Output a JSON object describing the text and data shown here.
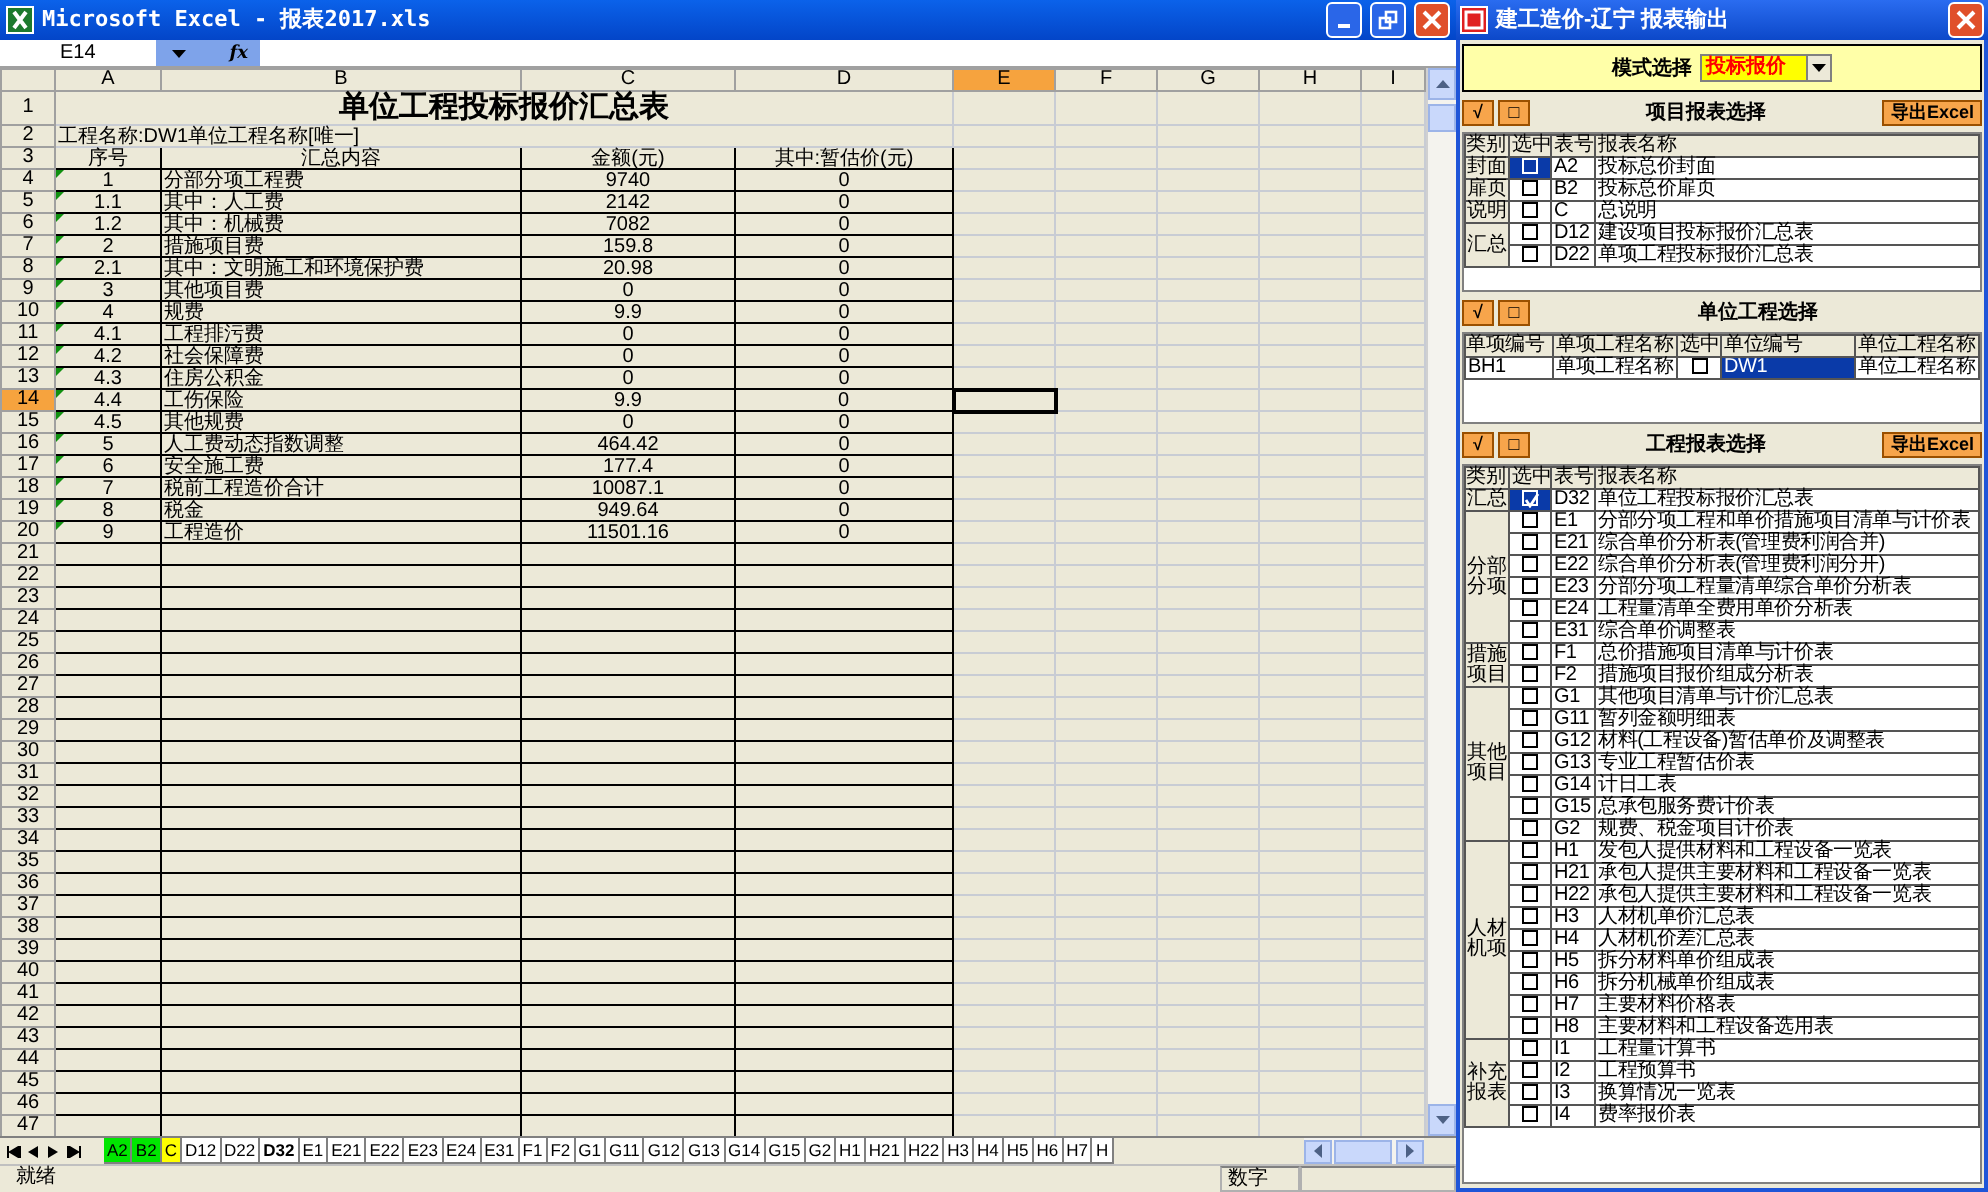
{
  "excel": {
    "title": "Microsoft Excel - 报表2017.xls",
    "name_box": "E14",
    "fx": "fx",
    "columns": [
      {
        "label": "A",
        "selected": false
      },
      {
        "label": "B",
        "selected": false
      },
      {
        "label": "C",
        "selected": false
      },
      {
        "label": "D",
        "selected": false
      },
      {
        "label": "E",
        "selected": true
      },
      {
        "label": "F",
        "selected": false
      },
      {
        "label": "G",
        "selected": false
      },
      {
        "label": "H",
        "selected": false
      },
      {
        "label": "I",
        "selected": false
      }
    ],
    "row_headers": [
      {
        "label": "1",
        "selected": false
      },
      {
        "label": "2",
        "selected": false
      },
      {
        "label": "3",
        "selected": false
      },
      {
        "label": "4",
        "selected": false
      },
      {
        "label": "5",
        "selected": false
      },
      {
        "label": "6",
        "selected": false
      },
      {
        "label": "7",
        "selected": false
      },
      {
        "label": "8",
        "selected": false
      },
      {
        "label": "9",
        "selected": false
      },
      {
        "label": "10",
        "selected": false
      },
      {
        "label": "11",
        "selected": false
      },
      {
        "label": "12",
        "selected": false
      },
      {
        "label": "13",
        "selected": false
      },
      {
        "label": "14",
        "selected": true
      },
      {
        "label": "15",
        "selected": false
      },
      {
        "label": "16",
        "selected": false
      },
      {
        "label": "17",
        "selected": false
      },
      {
        "label": "18",
        "selected": false
      },
      {
        "label": "19",
        "selected": false
      },
      {
        "label": "20",
        "selected": false
      },
      {
        "label": "21",
        "selected": false
      },
      {
        "label": "22",
        "selected": false
      },
      {
        "label": "23",
        "selected": false
      },
      {
        "label": "24",
        "selected": false
      },
      {
        "label": "25",
        "selected": false
      },
      {
        "label": "26",
        "selected": false
      },
      {
        "label": "27",
        "selected": false
      },
      {
        "label": "28",
        "selected": false
      },
      {
        "label": "29",
        "selected": false
      },
      {
        "label": "30",
        "selected": false
      },
      {
        "label": "31",
        "selected": false
      },
      {
        "label": "32",
        "selected": false
      },
      {
        "label": "33",
        "selected": false
      },
      {
        "label": "34",
        "selected": false
      },
      {
        "label": "35",
        "selected": false
      },
      {
        "label": "36",
        "selected": false
      },
      {
        "label": "37",
        "selected": false
      },
      {
        "label": "38",
        "selected": false
      },
      {
        "label": "39",
        "selected": false
      },
      {
        "label": "40",
        "selected": false
      },
      {
        "label": "41",
        "selected": false
      },
      {
        "label": "42",
        "selected": false
      },
      {
        "label": "43",
        "selected": false
      },
      {
        "label": "44",
        "selected": false
      },
      {
        "label": "45",
        "selected": false
      },
      {
        "label": "46",
        "selected": false
      },
      {
        "label": "47",
        "selected": false
      }
    ],
    "sheet_title": "单位工程投标报价汇总表",
    "project_line": "工程名称:DW1单位工程名称[唯一]",
    "table_header": [
      "序号",
      "汇总内容",
      "金额(元)",
      "其中:暂估价(元)"
    ],
    "rows": [
      [
        "1",
        "分部分项工程费",
        "9740",
        "0"
      ],
      [
        "1.1",
        "其中：人工费",
        "2142",
        "0"
      ],
      [
        "1.2",
        "其中：机械费",
        "7082",
        "0"
      ],
      [
        "2",
        "措施项目费",
        "159.8",
        "0"
      ],
      [
        "2.1",
        "其中：文明施工和环境保护费",
        "20.98",
        "0"
      ],
      [
        "3",
        "其他项目费",
        "0",
        "0"
      ],
      [
        "4",
        "规费",
        "9.9",
        "0"
      ],
      [
        "4.1",
        "工程排污费",
        "0",
        "0"
      ],
      [
        "4.2",
        "社会保障费",
        "0",
        "0"
      ],
      [
        "4.3",
        "住房公积金",
        "0",
        "0"
      ],
      [
        "4.4",
        "工伤保险",
        "9.9",
        "0"
      ],
      [
        "4.5",
        "其他规费",
        "0",
        "0"
      ],
      [
        "5",
        "人工费动态指数调整",
        "464.42",
        "0"
      ],
      [
        "6",
        "安全施工费",
        "177.4",
        "0"
      ],
      [
        "7",
        "税前工程造价合计",
        "10087.1",
        "0"
      ],
      [
        "8",
        "税金",
        "949.64",
        "0"
      ],
      [
        "9",
        "工程造价",
        "11501.16",
        "0"
      ]
    ],
    "sheet_tabs": [
      {
        "label": "A2",
        "selected": false,
        "color": "#00e600"
      },
      {
        "label": "B2",
        "selected": false,
        "color": "#00e600"
      },
      {
        "label": "C",
        "selected": false,
        "color": "#ffff00"
      },
      {
        "label": "D12",
        "selected": false
      },
      {
        "label": "D22",
        "selected": false
      },
      {
        "label": "D32",
        "selected": true
      },
      {
        "label": "E1",
        "selected": false
      },
      {
        "label": "E21",
        "selected": false
      },
      {
        "label": "E22",
        "selected": false
      },
      {
        "label": "E23",
        "selected": false
      },
      {
        "label": "E24",
        "selected": false
      },
      {
        "label": "E31",
        "selected": false
      },
      {
        "label": "F1",
        "selected": false
      },
      {
        "label": "F2",
        "selected": false
      },
      {
        "label": "G1",
        "selected": false
      },
      {
        "label": "G11",
        "selected": false
      },
      {
        "label": "G12",
        "selected": false
      },
      {
        "label": "G13",
        "selected": false
      },
      {
        "label": "G14",
        "selected": false
      },
      {
        "label": "G15",
        "selected": false
      },
      {
        "label": "G2",
        "selected": false
      },
      {
        "label": "H1",
        "selected": false
      },
      {
        "label": "H21",
        "selected": false
      },
      {
        "label": "H22",
        "selected": false
      },
      {
        "label": "H3",
        "selected": false
      },
      {
        "label": "H4",
        "selected": false
      },
      {
        "label": "H5",
        "selected": false
      },
      {
        "label": "H6",
        "selected": false
      },
      {
        "label": "H7",
        "selected": false
      },
      {
        "label": "H",
        "selected": false
      }
    ],
    "status": "就绪",
    "status_mode": "数字"
  },
  "dialog": {
    "title": "建工造价-辽宁 报表输出",
    "mode_label": "模式选择",
    "mode_value": "投标报价",
    "project_section": {
      "check_all": "√",
      "uncheck_all": "□",
      "title": "项目报表选择",
      "export": "导出Excel",
      "columns": [
        "类别",
        "选中",
        "表号",
        "报表名称"
      ],
      "groups": [
        {
          "category": "封面",
          "items": [
            {
              "code": "A2",
              "name": "投标总价封面",
              "checked": false,
              "selected": true
            }
          ]
        },
        {
          "category": "扉页",
          "items": [
            {
              "code": "B2",
              "name": "投标总价扉页",
              "checked": false,
              "selected": false
            }
          ]
        },
        {
          "category": "说明",
          "items": [
            {
              "code": "C",
              "name": "总说明",
              "checked": false,
              "selected": false
            }
          ]
        },
        {
          "category": "汇总",
          "items": [
            {
              "code": "D12",
              "name": "建设项目投标报价汇总表",
              "checked": false,
              "selected": false
            },
            {
              "code": "D22",
              "name": "单项工程投标报价汇总表",
              "checked": false,
              "selected": false
            }
          ]
        }
      ]
    },
    "unit_section": {
      "check_all": "√",
      "uncheck_all": "□",
      "title": "单位工程选择",
      "columns": [
        "单项编号",
        "单项工程名称",
        "选中",
        "单位编号",
        "单位工程名称"
      ],
      "rows": [
        {
          "item_code": "BH1",
          "item_name": "单项工程名称",
          "checked": false,
          "unit_code": "DW1",
          "unit_name": "单位工程名称",
          "selected": true
        }
      ]
    },
    "report_section": {
      "check_all": "√",
      "uncheck_all": "□",
      "title": "工程报表选择",
      "export": "导出Excel",
      "columns": [
        "类别",
        "选中",
        "表号",
        "报表名称"
      ],
      "groups": [
        {
          "category": "汇总",
          "items": [
            {
              "code": "D32",
              "name": "单位工程投标报价汇总表",
              "checked": true,
              "selected": true
            }
          ]
        },
        {
          "category": "分部分项",
          "items": [
            {
              "code": "E1",
              "name": "分部分项工程和单价措施项目清单与计价表",
              "checked": false,
              "selected": false
            },
            {
              "code": "E21",
              "name": "综合单价分析表(管理费利润合并)",
              "checked": false,
              "selected": false
            },
            {
              "code": "E22",
              "name": "综合单价分析表(管理费利润分开)",
              "checked": false,
              "selected": false
            },
            {
              "code": "E23",
              "name": "分部分项工程量清单综合单价分析表",
              "checked": false,
              "selected": false
            },
            {
              "code": "E24",
              "name": "工程量清单全费用单价分析表",
              "checked": false,
              "selected": false
            },
            {
              "code": "E31",
              "name": "综合单价调整表",
              "checked": false,
              "selected": false
            }
          ]
        },
        {
          "category": "措施项目",
          "items": [
            {
              "code": "F1",
              "name": "总价措施项目清单与计价表",
              "checked": false,
              "selected": false
            },
            {
              "code": "F2",
              "name": "措施项目报价组成分析表",
              "checked": false,
              "selected": false
            }
          ]
        },
        {
          "category": "其他项目",
          "items": [
            {
              "code": "G1",
              "name": "其他项目清单与计价汇总表",
              "checked": false,
              "selected": false
            },
            {
              "code": "G11",
              "name": "暂列金额明细表",
              "checked": false,
              "selected": false
            },
            {
              "code": "G12",
              "name": "材料(工程设备)暂估单价及调整表",
              "checked": false,
              "selected": false
            },
            {
              "code": "G13",
              "name": "专业工程暂估价表",
              "checked": false,
              "selected": false
            },
            {
              "code": "G14",
              "name": "计日工表",
              "checked": false,
              "selected": false
            },
            {
              "code": "G15",
              "name": "总承包服务费计价表",
              "checked": false,
              "selected": false
            },
            {
              "code": "G2",
              "name": "规费、税金项目计价表",
              "checked": false,
              "selected": false
            }
          ]
        },
        {
          "category": "人材机项",
          "items": [
            {
              "code": "H1",
              "name": "发包人提供材料和工程设备一览表",
              "checked": false,
              "selected": false
            },
            {
              "code": "H21",
              "name": "承包人提供主要材料和工程设备一览表",
              "checked": false,
              "selected": false
            },
            {
              "code": "H22",
              "name": "承包人提供主要材料和工程设备一览表",
              "checked": false,
              "selected": false
            },
            {
              "code": "H3",
              "name": "人材机单价汇总表",
              "checked": false,
              "selected": false
            },
            {
              "code": "H4",
              "name": "人材机价差汇总表",
              "checked": false,
              "selected": false
            },
            {
              "code": "H5",
              "name": "拆分材料单价组成表",
              "checked": false,
              "selected": false
            },
            {
              "code": "H6",
              "name": "拆分机械单价组成表",
              "checked": false,
              "selected": false
            },
            {
              "code": "H7",
              "name": "主要材料价格表",
              "checked": false,
              "selected": false
            },
            {
              "code": "H8",
              "name": "主要材料和工程设备选用表",
              "checked": false,
              "selected": false
            }
          ]
        },
        {
          "category": "补充报表",
          "items": [
            {
              "code": "I1",
              "name": "工程量计算书",
              "checked": false,
              "selected": false
            },
            {
              "code": "I2",
              "name": "工程预算书",
              "checked": false,
              "selected": false
            },
            {
              "code": "I3",
              "name": "换算情况一览表",
              "checked": false,
              "selected": false
            },
            {
              "code": "I4",
              "name": "费率报价表",
              "checked": false,
              "selected": false
            }
          ]
        }
      ]
    }
  }
}
